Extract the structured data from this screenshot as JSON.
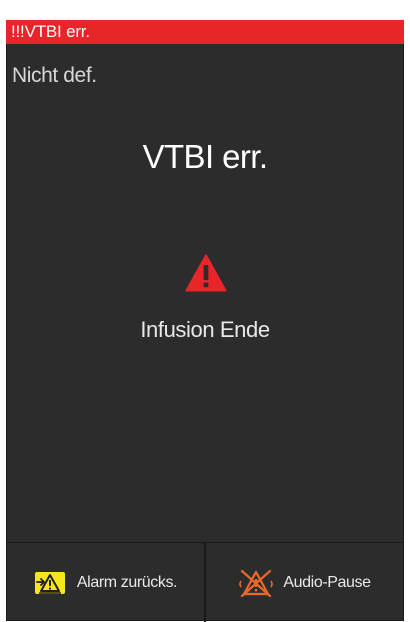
{
  "status_bar": {
    "alarm_text": "!!!VTBI err.",
    "color": "#e8262a"
  },
  "drug": {
    "name": "Nicht def."
  },
  "alarm": {
    "title": "VTBI err.",
    "message": "Infusion Ende",
    "icon": "warning-triangle-icon",
    "icon_color": "#e8262a"
  },
  "softkeys": [
    {
      "label": "Alarm zurücks.",
      "icon": "alarm-reset-icon",
      "icon_color": "#f6e61b"
    },
    {
      "label": "Audio-Pause",
      "icon": "audio-pause-icon",
      "icon_color": "#e86a2a"
    }
  ],
  "colors": {
    "screen_background": "#2c2c2c",
    "text": "#ffffff"
  }
}
